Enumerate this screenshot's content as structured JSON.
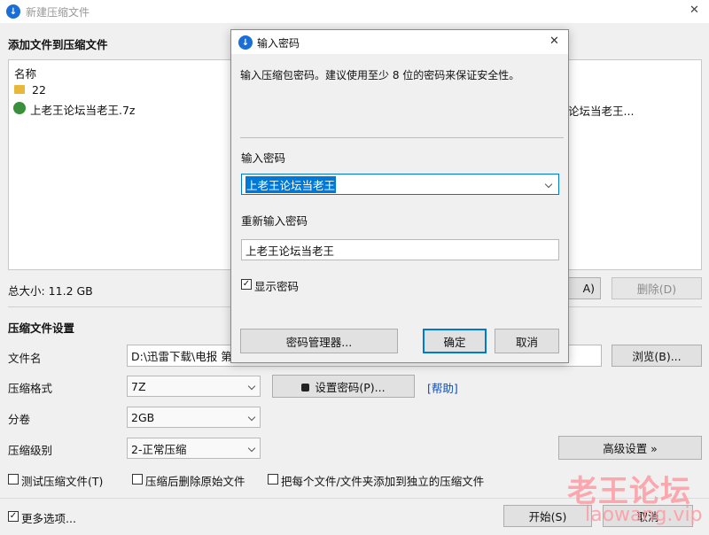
{
  "window": {
    "title": "新建压缩文件",
    "close_glyph": "✕"
  },
  "add_files": {
    "heading": "添加文件到压缩文件",
    "list_header": "名称",
    "items": [
      {
        "name": "22",
        "icon": "folder-icon"
      },
      {
        "name": "上老王论坛当老王.7z",
        "icon": "7z-archive-icon"
      }
    ],
    "right_truncated": "论坛当老王...",
    "total_size": "总大小: 11.2 GB",
    "add_btn_fragment": "A)",
    "delete_btn": "删除(D)"
  },
  "settings": {
    "heading": "压缩文件设置",
    "filename_label": "文件名",
    "filename_value": "D:\\迅雷下载\\电报 第",
    "browse_btn": "浏览(B)...",
    "format_label": "压缩格式",
    "format_value": "7Z",
    "set_password_btn": "设置密码(P)...",
    "help_link": "[帮助]",
    "split_label": "分卷",
    "split_value": "2GB",
    "level_label": "压缩级别",
    "level_value": "2-正常压缩",
    "advanced_btn": "高级设置 »",
    "test_checkbox": "测试压缩文件(T)",
    "delete_after_checkbox": "压缩后删除原始文件",
    "separate_checkbox": "把每个文件/文件夹添加到独立的压缩文件",
    "more_options_checkbox": "更多选项...",
    "start_btn": "开始(S)",
    "cancel_btn": "取消"
  },
  "watermark": {
    "text1": "老王论坛",
    "text2": "laowang.vip"
  },
  "dialog": {
    "title": "输入密码",
    "close_glyph": "✕",
    "description": "输入压缩包密码。建议使用至少 8 位的密码来保证安全性。",
    "password_label": "输入密码",
    "password_value": "上老王论坛当老王",
    "reenter_label": "重新输入密码",
    "reenter_value": "上老王论坛当老王",
    "show_password_checkbox": "显示密码",
    "manager_btn": "密码管理器...",
    "ok_btn": "确定",
    "cancel_btn": "取消"
  },
  "colors": {
    "accent": "#0078d7",
    "selection": "#0078d7",
    "link": "#0050c8",
    "watermark": "#ff9aa2"
  }
}
